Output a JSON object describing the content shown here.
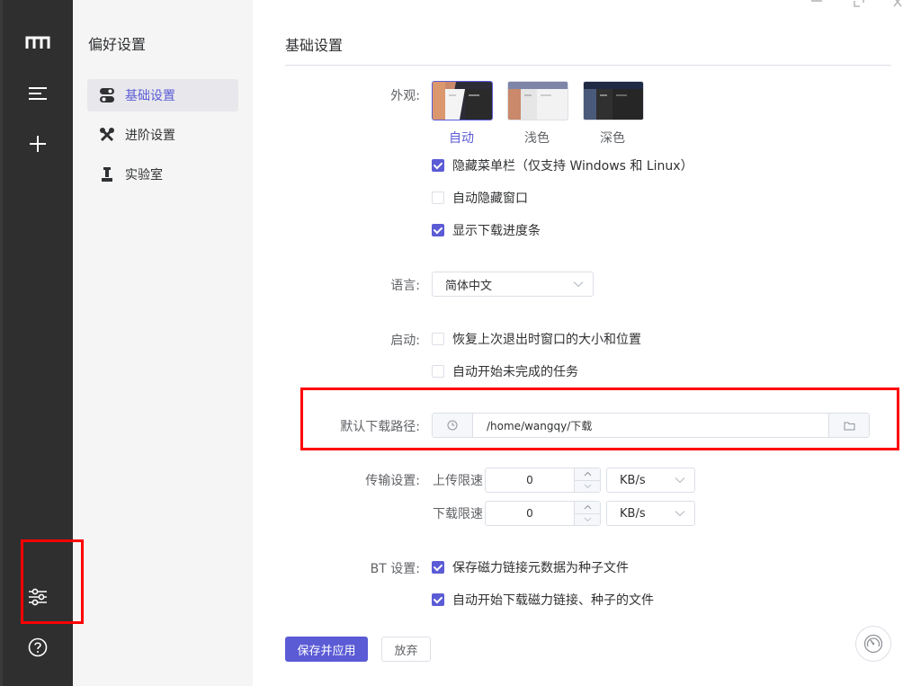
{
  "sidebar": {
    "logo_icon": "motrix-logo-icon",
    "icons": [
      "menu-icon",
      "add-icon",
      "preferences-icon",
      "help-icon"
    ]
  },
  "subnav": {
    "title": "偏好设置",
    "items": [
      {
        "label": "基础设置",
        "icon": "toggle-icon",
        "active": true
      },
      {
        "label": "进阶设置",
        "icon": "tools-icon",
        "active": false
      },
      {
        "label": "实验室",
        "icon": "lab-icon",
        "active": false
      }
    ]
  },
  "main": {
    "title": "基础设置",
    "appearance": {
      "label": "外观:",
      "options": [
        {
          "label": "自动",
          "selected": true
        },
        {
          "label": "浅色",
          "selected": false
        },
        {
          "label": "深色",
          "selected": false
        }
      ]
    },
    "checks": {
      "hide_menubar": {
        "label": "隐藏菜单栏（仅支持 Windows 和 Linux）",
        "checked": true
      },
      "auto_hide_window": {
        "label": "自动隐藏窗口",
        "checked": false
      },
      "show_progress": {
        "label": "显示下载进度条",
        "checked": true
      }
    },
    "language": {
      "label": "语言:",
      "value": "简体中文"
    },
    "startup": {
      "label": "启动:",
      "restore_window": {
        "label": "恢复上次退出时窗口的大小和位置",
        "checked": false
      },
      "auto_resume": {
        "label": "自动开始未完成的任务",
        "checked": false
      }
    },
    "download_path": {
      "label": "默认下载路径:",
      "value": "/home/wangqy/下载"
    },
    "transfer": {
      "label": "传输设置:",
      "upload": {
        "label": "上传限速",
        "value": "0",
        "unit": "KB/s"
      },
      "download": {
        "label": "下载限速",
        "value": "0",
        "unit": "KB/s"
      }
    },
    "bt": {
      "label": "BT 设置:",
      "save_magnet": {
        "label": "保存磁力链接元数据为种子文件",
        "checked": true
      },
      "auto_start": {
        "label": "自动开始下载磁力链接、种子的文件",
        "checked": true
      }
    },
    "buttons": {
      "save": "保存并应用",
      "discard": "放弃"
    }
  },
  "colors": {
    "accent": "#5b5bd6",
    "highlight": "#ff0000",
    "sidebar_bg": "#2f2f2f"
  }
}
